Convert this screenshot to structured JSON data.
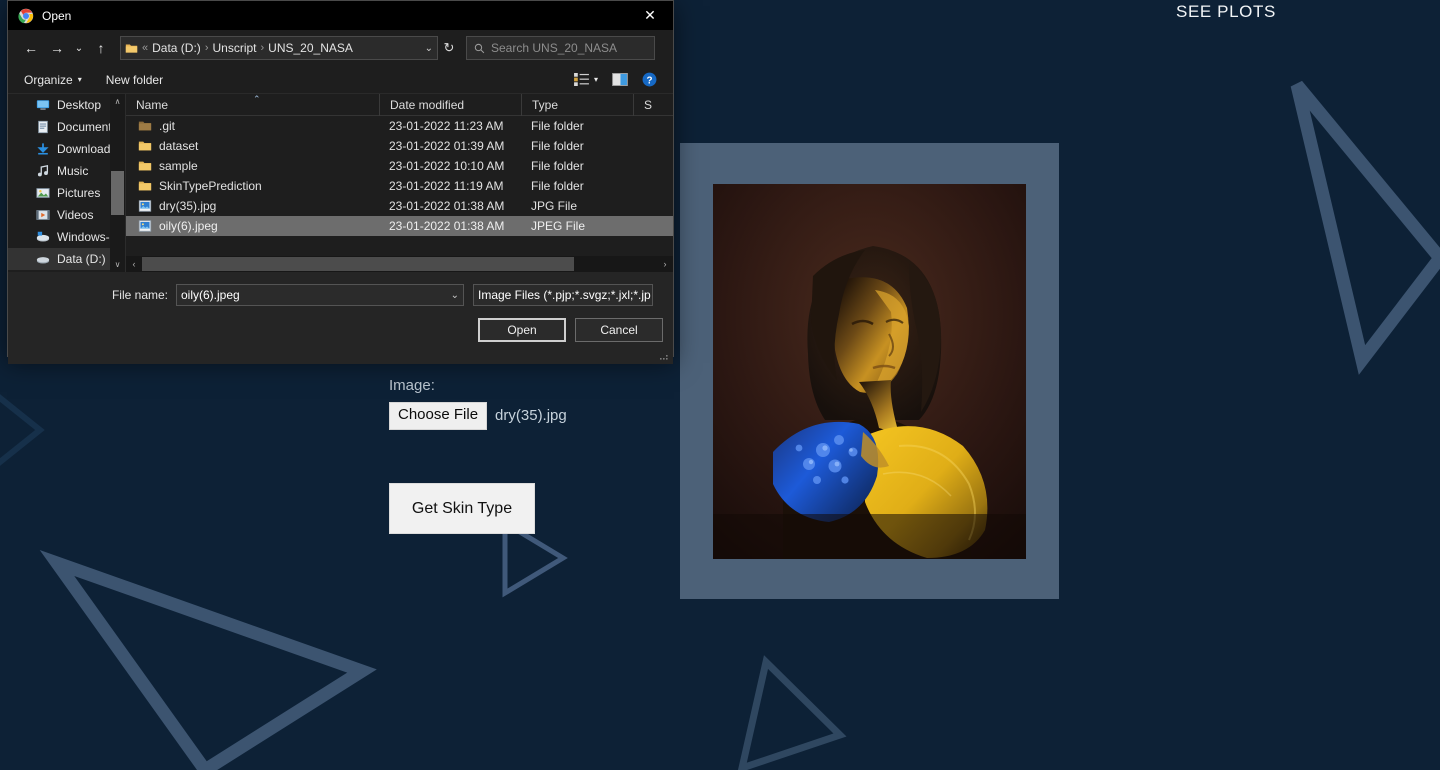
{
  "page": {
    "see_plots": "SEE PLOTS",
    "image_label": "Image:",
    "choose_file_button": "Choose File",
    "chosen_file_name": "dry(35).jpg",
    "get_skin_type_button": "Get Skin Type",
    "background_color": "#0d2136",
    "accent_triangle_color": "#3c5470",
    "photo_frame_color": "#4c6178",
    "button_face_color": "#f1f1f1"
  },
  "dialog": {
    "title": "Open",
    "close_label": "✕",
    "nav": {
      "back": "←",
      "forward": "→",
      "recent": "⌄",
      "up": "↑",
      "refresh": "↻",
      "address_prefix": "«",
      "address_segments": [
        "Data (D:)",
        "Unscript",
        "UNS_20_NASA"
      ],
      "address_separator": "›",
      "address_dropdown": "⌄",
      "search_placeholder": "Search UNS_20_NASA"
    },
    "toolbar": {
      "organize": "Organize",
      "organize_caret": "▾",
      "new_folder": "New folder",
      "view_caret": "▾"
    },
    "nav_pane": {
      "items": [
        {
          "label": "Desktop",
          "icon": "desktop-icon"
        },
        {
          "label": "Documents",
          "icon": "documents-icon"
        },
        {
          "label": "Downloads",
          "icon": "downloads-icon"
        },
        {
          "label": "Music",
          "icon": "music-icon"
        },
        {
          "label": "Pictures",
          "icon": "pictures-icon"
        },
        {
          "label": "Videos",
          "icon": "videos-icon"
        },
        {
          "label": "Windows-SSD (C",
          "icon": "drive-icon"
        },
        {
          "label": "Data (D:)",
          "icon": "drive-icon",
          "selected": true
        }
      ],
      "scroll_up": "∧",
      "scroll_down": "∨"
    },
    "file_list": {
      "columns": [
        "Name",
        "Date modified",
        "Type",
        "S"
      ],
      "sort_indicator": "⌃",
      "rows": [
        {
          "name": ".git",
          "date": "23-01-2022 11:23 AM",
          "type": "File folder",
          "kind": "folder",
          "selected": false
        },
        {
          "name": "dataset",
          "date": "23-01-2022 01:39 AM",
          "type": "File folder",
          "kind": "folder",
          "selected": false
        },
        {
          "name": "sample",
          "date": "23-01-2022 10:10 AM",
          "type": "File folder",
          "kind": "folder",
          "selected": false
        },
        {
          "name": "SkinTypePrediction",
          "date": "23-01-2022 11:19 AM",
          "type": "File folder",
          "kind": "folder",
          "selected": false
        },
        {
          "name": "dry(35).jpg",
          "date": "23-01-2022 01:38 AM",
          "type": "JPG File",
          "kind": "image",
          "selected": false
        },
        {
          "name": "oily(6).jpeg",
          "date": "23-01-2022 01:38 AM",
          "type": "JPEG File",
          "kind": "image",
          "selected": true
        }
      ],
      "hscroll_left": "‹",
      "hscroll_right": "›"
    },
    "footer": {
      "filename_label": "File name:",
      "filename_value": "oily(6).jpeg",
      "filetype_value": "Image Files (*.pjp;*.svgz;*.jxl;*.jp",
      "dropdown_caret": "⌄",
      "open_button": "Open",
      "cancel_button": "Cancel"
    }
  }
}
